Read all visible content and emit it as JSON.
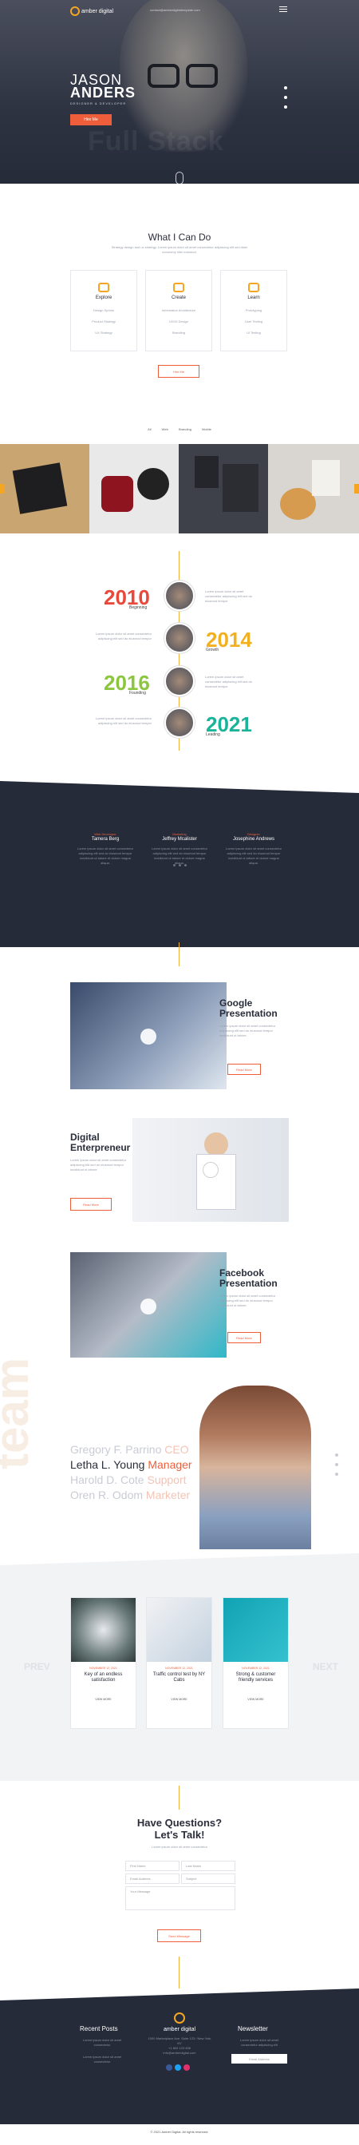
{
  "header": {
    "brand": "amber digital",
    "email": "contact@amberdigitaltemplate.com"
  },
  "hero": {
    "first_name": "JASON",
    "last_name": "ANDERS",
    "subtitle": "DESIGNER & DEVELOPER",
    "button": "Hire Me",
    "ghost_text": "Full Stack"
  },
  "services": {
    "title": "What I Can Do",
    "intro": "Strategy design and ux strategy. Lorem ipsum dolor sit amet consectetur adipiscing elit sed diam nonummy nibh euismod.",
    "cards": [
      {
        "title": "Explore",
        "icon": "lightbulb-icon",
        "items": [
          "Design Sprints",
          "Product Strategy",
          "UX Strategy"
        ]
      },
      {
        "title": "Create",
        "icon": "box-icon",
        "items": [
          "Information Architecture",
          "UX/UI Design",
          "Branding"
        ]
      },
      {
        "title": "Learn",
        "icon": "chart-icon",
        "items": [
          "Prototyping",
          "User Testing",
          "UI Testing"
        ]
      }
    ],
    "button": "Hire Me"
  },
  "portfolio": {
    "filters": [
      "All",
      "Web",
      "Branding",
      "Mobile"
    ]
  },
  "timeline": [
    {
      "year": "2010",
      "label": "Beginning",
      "color": "#e8493b",
      "text": "Lorem ipsum dolor sit amet consectetur adipiscing elit sed do eiusmod tempor"
    },
    {
      "year": "2014",
      "label": "Growth",
      "color": "#f2b01e",
      "text": "Lorem ipsum dolor sit amet consectetur adipiscing elit sed do eiusmod tempor"
    },
    {
      "year": "2016",
      "label": "Founding",
      "color": "#8cc63f",
      "text": "Lorem ipsum dolor sit amet consectetur adipiscing elit sed do eiusmod tempor"
    },
    {
      "year": "2021",
      "label": "Leading",
      "color": "#1bb39a",
      "text": "Lorem ipsum dolor sit amet consectetur adipiscing elit sed do eiusmod tempor"
    }
  ],
  "testimonials": [
    {
      "role": "Web Developer",
      "name": "Tamera Berg",
      "text": "Lorem ipsum dolor sit amet consectetur adipiscing elit sed do eiusmod tempor incididunt ut labore et dolore magna aliqua."
    },
    {
      "role": "Marketing",
      "name": "Jeffrey Mcalister",
      "text": "Lorem ipsum dolor sit amet consectetur adipiscing elit sed do eiusmod tempor incididunt ut labore et dolore magna aliqua."
    },
    {
      "role": "Designer",
      "name": "Josephine Andrews",
      "text": "Lorem ipsum dolor sit amet consectetur adipiscing elit sed do eiusmod tempor incididunt ut labore et dolore magna aliqua."
    }
  ],
  "videos": [
    {
      "title1": "Google",
      "title2": "Presentation",
      "button": "Read More",
      "text": "Lorem ipsum dolor sit amet consectetur adipiscing elit sed do eiusmod tempor incididunt ut labore."
    },
    {
      "title1": "Digital",
      "title2": "Enterpreneur",
      "button": "Read More",
      "text": "Lorem ipsum dolor sit amet consectetur adipiscing elit sed do eiusmod tempor incididunt ut labore."
    },
    {
      "title1": "Facebook",
      "title2": "Presentation",
      "button": "Read More",
      "text": "Lorem ipsum dolor sit amet consectetur adipiscing elit sed do eiusmod tempor incididunt ut labore."
    }
  ],
  "team": {
    "ghost": "team",
    "members": [
      {
        "name": "Gregory F. Parrino",
        "role": "CEO"
      },
      {
        "name": "Letha L. Young",
        "role": "Manager"
      },
      {
        "name": "Harold D. Cote",
        "role": "Support"
      },
      {
        "name": "Oren R. Odom",
        "role": "Marketer"
      }
    ]
  },
  "blog": {
    "prev": "PREV",
    "next": "NEXT",
    "posts": [
      {
        "date": "NOVEMBER 12, 2021",
        "title": "Key of an endless satisfaction",
        "more": "VIEW MORE"
      },
      {
        "date": "NOVEMBER 12, 2021",
        "title": "Traffic control test by NY Cabs",
        "more": "VIEW MORE"
      },
      {
        "date": "NOVEMBER 12, 2021",
        "title": "Strong & customer friendly services",
        "more": "VIEW MORE"
      }
    ]
  },
  "contact": {
    "title1": "Have Questions?",
    "title2": "Let's Talk!",
    "intro": "Lorem ipsum dolor sit amet consectetur",
    "first_name": "First Name",
    "last_name": "Last Name",
    "email": "Email Address",
    "subject": "Subject",
    "message": "Your Message",
    "button": "Send Message"
  },
  "footer": {
    "recent_title": "Recent Posts",
    "posts": [
      "Lorem ipsum dolor sit amet consectetur",
      "Lorem ipsum dolor sit amet consectetur"
    ],
    "brand": "amber digital",
    "address": "1000 Marketplace Ave. Suite 123 / New York NY",
    "phone": "+1 800 123 456",
    "mail": "info@amberdigital.com",
    "newsletter_title": "Newsletter",
    "newsletter_text": "Lorem ipsum dolor sit amet consectetur adipiscing elit",
    "newsletter_placeholder": "Email Address",
    "copyright": "© 2021 Amber Digital. All rights reserved."
  }
}
